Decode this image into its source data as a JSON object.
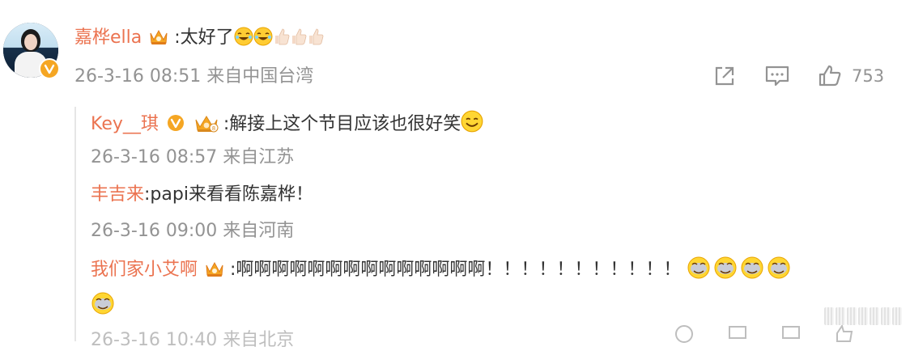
{
  "comment": {
    "username": "嘉桦ella",
    "text": ":太好了",
    "emojis": [
      "laughing-emoji",
      "laughing-emoji"
    ],
    "thumbs": [
      "thumbs-up-emoji",
      "thumbs-up-emoji",
      "thumbs-up-emoji"
    ],
    "meta": "26-3-16 08:51 来自中国台湾",
    "actions": {
      "share_icon": "share-icon",
      "comment_icon": "comment-icon",
      "like_icon": "like-icon",
      "like_count": "753"
    }
  },
  "replies": [
    {
      "username": "Key__琪",
      "text": ":解接上这个节目应该也很好笑",
      "meta": "26-3-16 08:57 来自江苏"
    },
    {
      "username": "丰吉来",
      "text": ":papi来看看陈嘉桦！",
      "meta": "26-3-16 09:00 来自河南"
    },
    {
      "username": "我们家小艾啊",
      "text": ":啊啊啊啊啊啊啊啊啊啊啊啊啊啊！！！！！！！！！！！",
      "meta": "26-3-16 10:40 来自北京"
    }
  ],
  "colors": {
    "username": "#eb7350",
    "meta": "#939393",
    "crown": "#f5a623"
  }
}
